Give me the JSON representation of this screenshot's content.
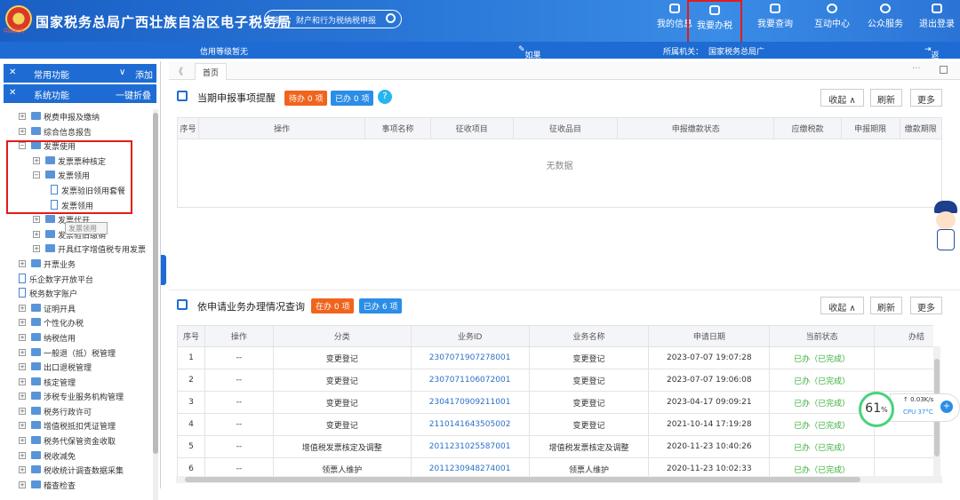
{
  "header": {
    "emblem_text": "中国税务",
    "title": "国家税务总局广西壮族自治区电子税务局",
    "search_placeholder": "搜索：财产和行为税纳税申报",
    "nav": [
      "我的信息",
      "我要办税",
      "我要查询",
      "互动中心",
      "公众服务",
      "退出登录"
    ]
  },
  "subbar": {
    "credit": "信用等级暂无",
    "notice": "如果申报表打开有问题，点这里",
    "org_label": "所属机关：",
    "org_value": "国家税务总局广",
    "back": "返回"
  },
  "sidebar": {
    "common": "常用功能",
    "common_toggle": "∨",
    "common_action": "添加",
    "system": "系统功能",
    "system_action": "一键折叠",
    "items": [
      {
        "label": "税费申报及缴纳",
        "level": 1,
        "type": "folder",
        "expander": "+"
      },
      {
        "label": "综合信息报告",
        "level": 1,
        "type": "folder",
        "expander": "+"
      },
      {
        "label": "发票使用",
        "level": 1,
        "type": "folder",
        "expander": "−"
      },
      {
        "label": "发票票种核定",
        "level": 2,
        "type": "folder",
        "expander": "+"
      },
      {
        "label": "发票领用",
        "level": 2,
        "type": "folder",
        "expander": "−"
      },
      {
        "label": "发票验旧领用套餐",
        "level": 3,
        "type": "doc",
        "expander": ""
      },
      {
        "label": "发票领用",
        "level": 3,
        "type": "doc",
        "expander": ""
      },
      {
        "label": "发票代开",
        "level": 2,
        "type": "folder",
        "expander": "+"
      },
      {
        "label": "发票验旧缴销",
        "level": 2,
        "type": "folder",
        "expander": "+"
      },
      {
        "label": "开具红字增值税专用发票",
        "level": 2,
        "type": "folder",
        "expander": "+"
      },
      {
        "label": "开票业务",
        "level": 1,
        "type": "folder",
        "expander": "+"
      },
      {
        "label": "乐企数字开放平台",
        "level": 1,
        "type": "doc",
        "expander": ""
      },
      {
        "label": "税务数字账户",
        "level": 1,
        "type": "doc",
        "expander": ""
      },
      {
        "label": "证明开具",
        "level": 1,
        "type": "folder",
        "expander": "+"
      },
      {
        "label": "个性化办税",
        "level": 1,
        "type": "folder",
        "expander": "+"
      },
      {
        "label": "纳税信用",
        "level": 1,
        "type": "folder",
        "expander": "+"
      },
      {
        "label": "一般退（抵）税管理",
        "level": 1,
        "type": "folder",
        "expander": "+"
      },
      {
        "label": "出口退税管理",
        "level": 1,
        "type": "folder",
        "expander": "+"
      },
      {
        "label": "核定管理",
        "level": 1,
        "type": "folder",
        "expander": "+"
      },
      {
        "label": "涉税专业服务机构管理",
        "level": 1,
        "type": "folder",
        "expander": "+"
      },
      {
        "label": "税务行政许可",
        "level": 1,
        "type": "folder",
        "expander": "+"
      },
      {
        "label": "增值税抵扣凭证管理",
        "level": 1,
        "type": "folder",
        "expander": "+"
      },
      {
        "label": "税务代保管资金收取",
        "level": 1,
        "type": "folder",
        "expander": "+"
      },
      {
        "label": "税收减免",
        "level": 1,
        "type": "folder",
        "expander": "+"
      },
      {
        "label": "税收统计调查数据采集",
        "level": 1,
        "type": "folder",
        "expander": "+"
      },
      {
        "label": "稽查检查",
        "level": 1,
        "type": "folder",
        "expander": "+"
      }
    ],
    "tooltip": "发票领用"
  },
  "tabs": {
    "home": "首页",
    "collapse": "《",
    "more": "···"
  },
  "panel1": {
    "title": "当期申报事项提醒",
    "badge_todo": "待办 0 项",
    "badge_done": "已办 0 项",
    "help": "?",
    "collapse": "收起 ∧",
    "refresh": "刷新",
    "more": "更多",
    "columns": [
      "序号",
      "操作",
      "事项名称",
      "征收项目",
      "征收品目",
      "申报缴款状态",
      "应缴税款",
      "申报期限",
      "缴款期限"
    ],
    "empty": "无数据"
  },
  "panel2": {
    "title": "依申请业务办理情况查询",
    "badge_doing": "在办 0 项",
    "badge_done": "已办 6 项",
    "collapse": "收起 ∧",
    "refresh": "刷新",
    "more": "更多",
    "columns": [
      "序号",
      "操作",
      "分类",
      "业务ID",
      "业务名称",
      "申请日期",
      "当前状态",
      "办结"
    ],
    "rows": [
      [
        "1",
        "--",
        "变更登记",
        "2307071907278001",
        "变更登记",
        "2023-07-07 19:07:28",
        "已办（已完成）"
      ],
      [
        "2",
        "--",
        "变更登记",
        "2307071106072001",
        "变更登记",
        "2023-07-07 19:06:08",
        "已办（已完成）"
      ],
      [
        "3",
        "--",
        "变更登记",
        "2304170909211001",
        "变更登记",
        "2023-04-17 09:09:21",
        "已办（已完成）"
      ],
      [
        "4",
        "--",
        "变更登记",
        "2110141643505002",
        "变更登记",
        "2021-10-14 17:19:28",
        "已办（已完成）"
      ],
      [
        "5",
        "--",
        "增值税发票核定及调整",
        "2011231025587001",
        "增值税发票核定及调整",
        "2020-11-23 10:40:26",
        "已办（已完成）"
      ],
      [
        "6",
        "--",
        "领票人维护",
        "2011230948274001",
        "领票人维护",
        "2020-11-23 10:02:33",
        "已办（已完成）"
      ]
    ]
  },
  "perf": {
    "percent": "61",
    "unit": "%",
    "speed": "0.03K/s",
    "cpu": "CPU 37°C",
    "plus": "+"
  },
  "colors": {
    "brand": "#1e6cd3",
    "highlight": "#e51a1a",
    "todo": "#f0641e",
    "done": "#2b8de6",
    "ok": "#3cae3c"
  }
}
